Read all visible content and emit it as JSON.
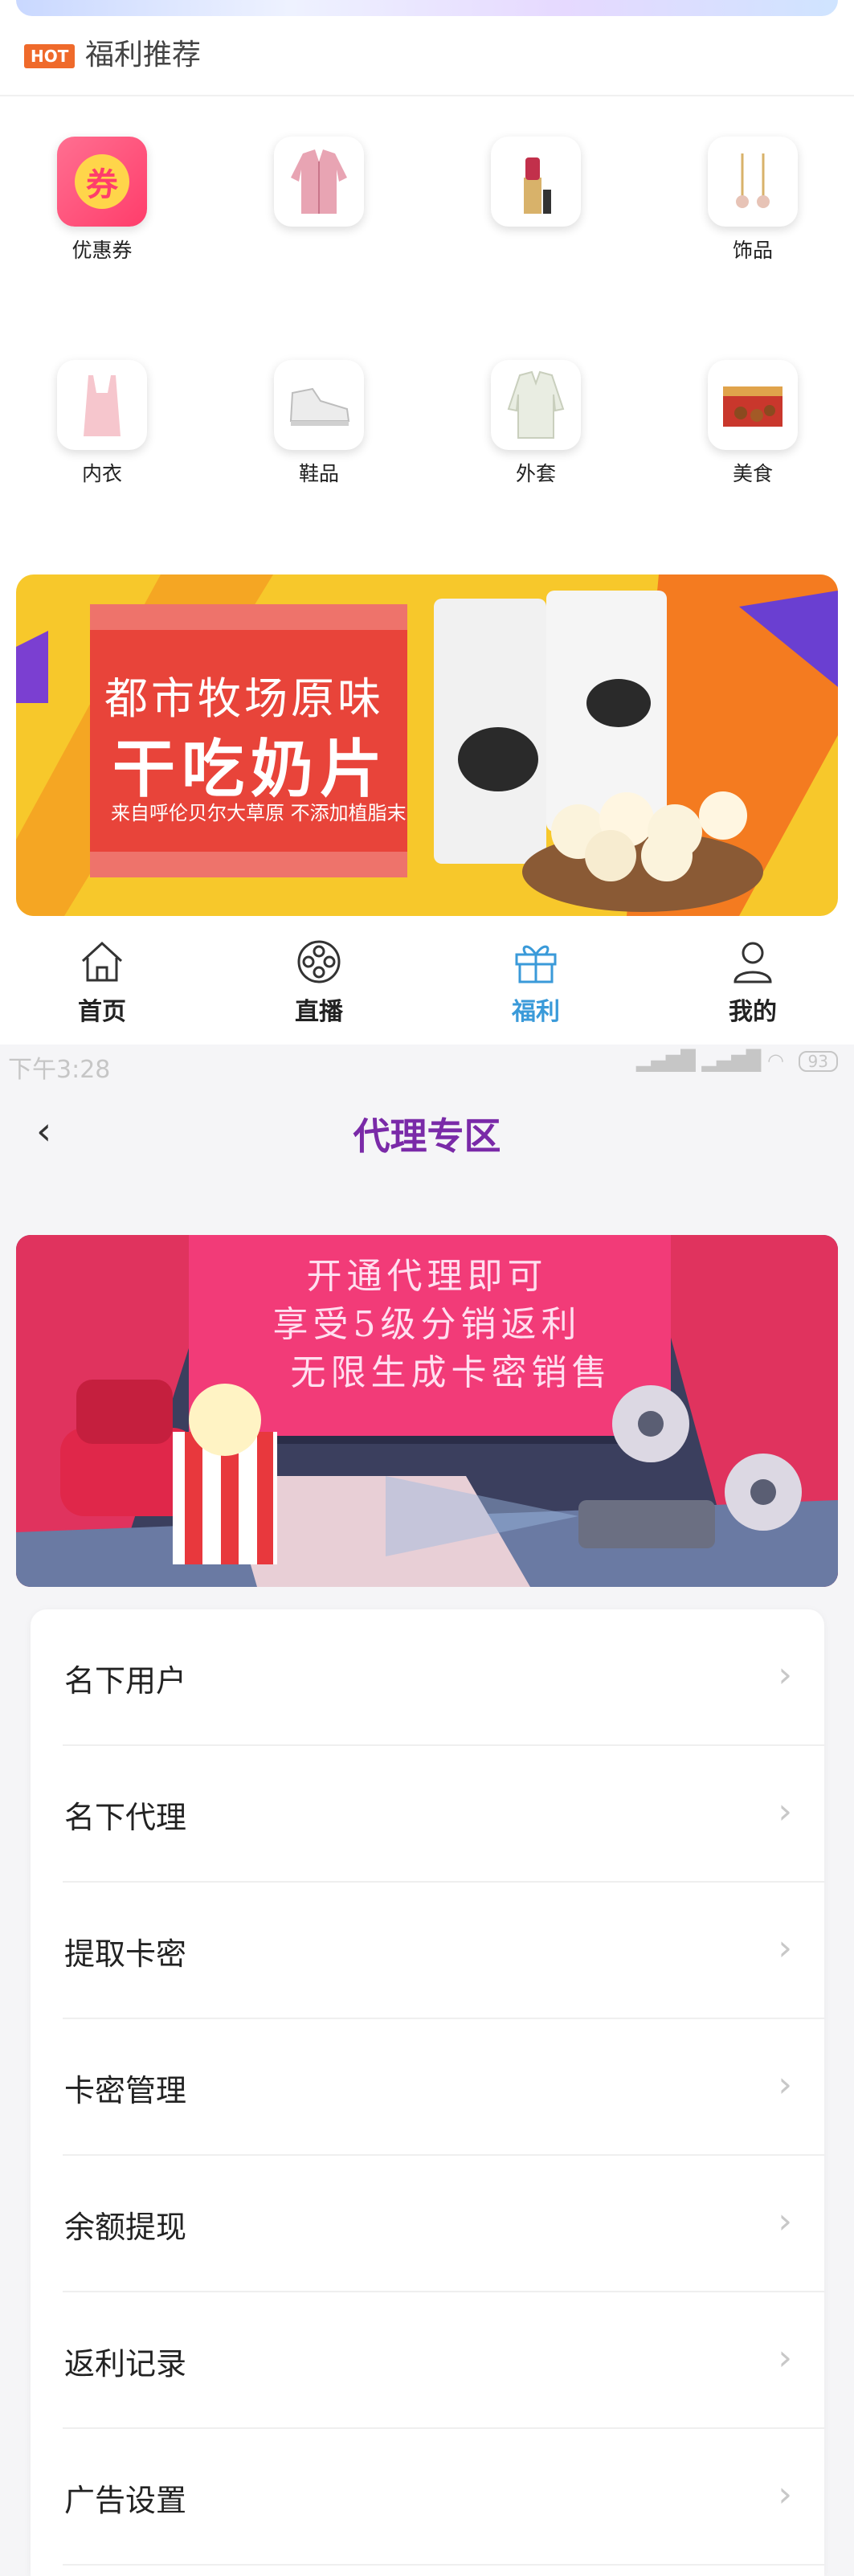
{
  "section": {
    "badge": "HOT",
    "title": "福利推荐"
  },
  "categories": [
    {
      "label": "优惠券",
      "icon": "coupon-icon"
    },
    {
      "label": "",
      "icon": "jacket-icon"
    },
    {
      "label": "",
      "icon": "lipstick-icon"
    },
    {
      "label": "饰品",
      "icon": "earrings-icon"
    },
    {
      "label": "内衣",
      "icon": "camisole-icon"
    },
    {
      "label": "鞋品",
      "icon": "sneaker-icon"
    },
    {
      "label": "外套",
      "icon": "coat-icon"
    },
    {
      "label": "美食",
      "icon": "snack-box-icon"
    }
  ],
  "ad": {
    "title1": "都市牧场原味",
    "title2": "干吃奶片",
    "sub": "来自呼伦贝尔大草原 不添加植脂末"
  },
  "bottom_nav": [
    {
      "label": "首页",
      "icon": "home-icon"
    },
    {
      "label": "直播",
      "icon": "film-reel-icon"
    },
    {
      "label": "福利",
      "icon": "gift-icon"
    },
    {
      "label": "我的",
      "icon": "user-icon"
    }
  ],
  "status_bar": {
    "time": "下午3:28",
    "battery": "93"
  },
  "agent_page": {
    "title": "代理专区",
    "banner_lines": [
      "开通代理即可",
      "享受5级分销返利",
      "无限生成卡密销售"
    ],
    "menu": [
      "名下用户",
      "名下代理",
      "提取卡密",
      "卡密管理",
      "余额提现",
      "返利记录",
      "广告设置"
    ]
  },
  "colors": {
    "accent": "#3a9ad9",
    "title": "#7a2aa8",
    "hot": "#ef6a2b"
  }
}
